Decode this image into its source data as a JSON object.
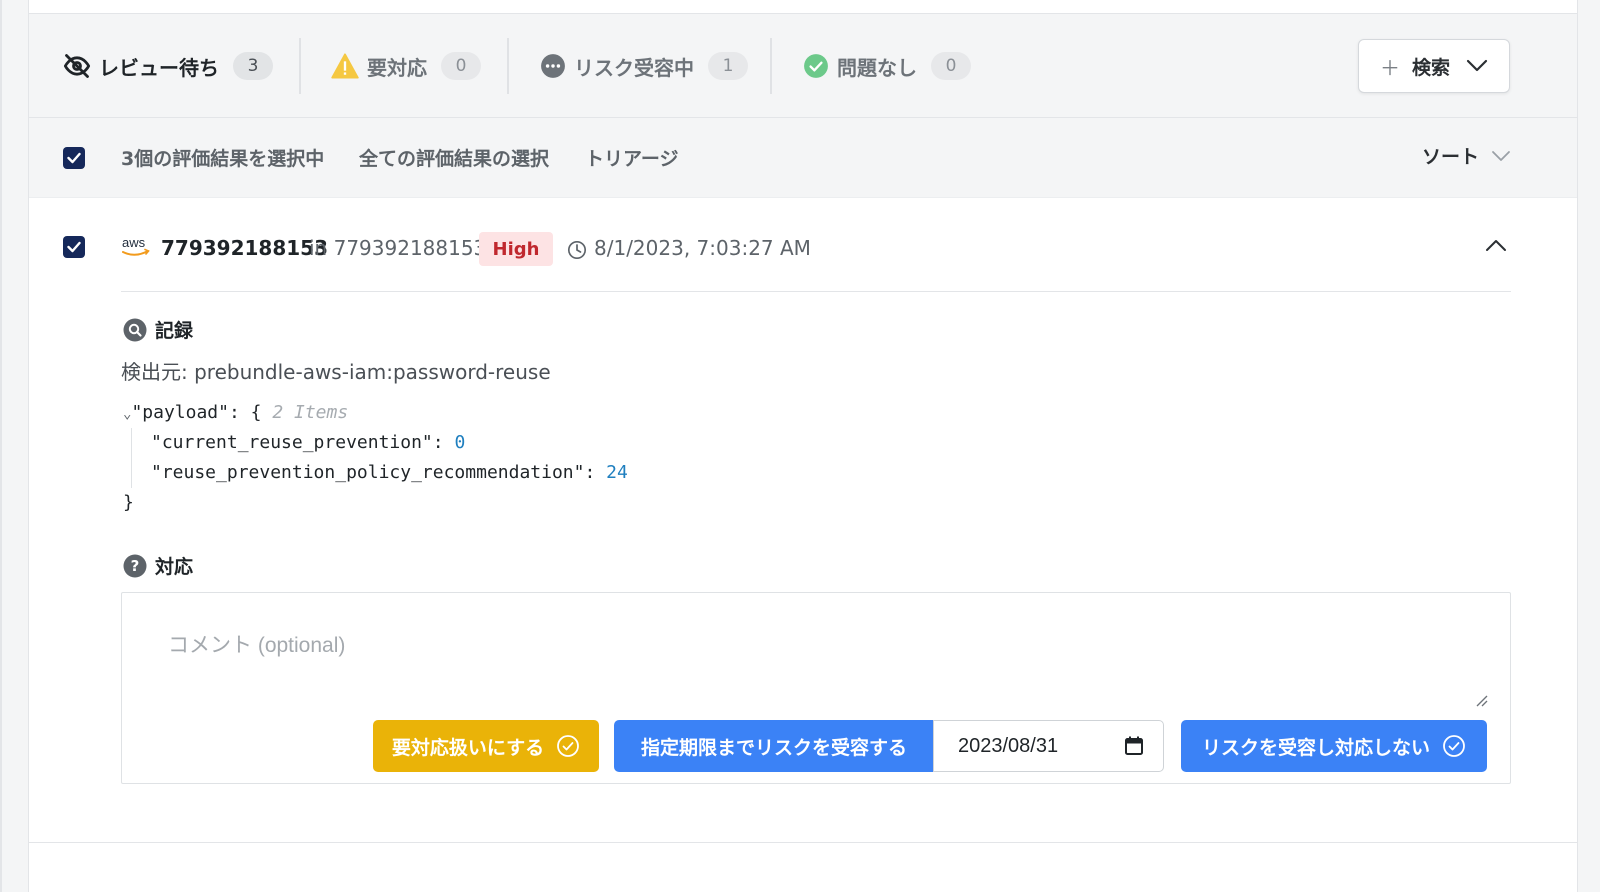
{
  "tabs": [
    {
      "label": "レビュー待ち",
      "count": "3",
      "icon": "eye-off-icon"
    },
    {
      "label": "要対応",
      "count": "0",
      "icon": "warning-icon"
    },
    {
      "label": "リスク受容中",
      "count": "1",
      "icon": "more-icon"
    },
    {
      "label": "問題なし",
      "count": "0",
      "icon": "check-circle-icon"
    }
  ],
  "search": {
    "label": "検索"
  },
  "selection": {
    "selected_text": "3個の評価結果を選択中",
    "select_all": "全ての評価結果の選択",
    "triage": "トリアージ",
    "sort": "ソート"
  },
  "finding": {
    "account": "779392188153",
    "in_account": "in 779392188153",
    "severity": "High",
    "timestamp": "8/1/2023, 7:03:27 AM",
    "provider_icon": "aws-icon",
    "record_title": "記録",
    "source": "検出元: prebundle-aws-iam:password-reuse",
    "payload": {
      "open": "\"payload\": {",
      "items_hint": "2 Items",
      "line1_key": "\"current_reuse_prevention\": ",
      "line1_val": "0",
      "line2_key": "\"reuse_prevention_policy_recommendation\": ",
      "line2_val": "24",
      "close": "}"
    },
    "response_title": "対応",
    "comment_placeholder": "コメント (optional)",
    "actions": {
      "require_action": "要対応扱いにする",
      "accept_until": "指定期限までリスクを受容する",
      "date_value": "2023/08/31",
      "accept_no_action": "リスクを受容し対応しない"
    }
  },
  "colors": {
    "navy": "#15285a",
    "yellow": "#eab308",
    "blue": "#3b82f6",
    "high_bg": "#fde3e4",
    "high_text": "#c0282e"
  }
}
